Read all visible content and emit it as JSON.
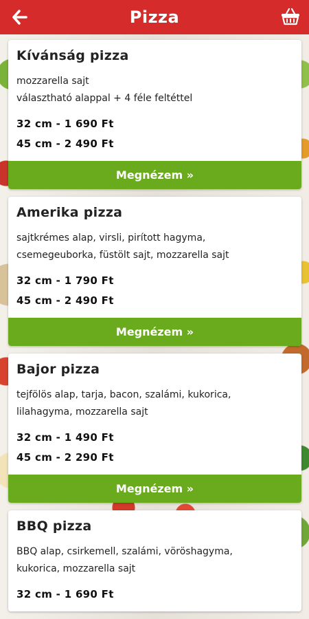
{
  "header": {
    "title": "Pizza",
    "back_icon": "arrow-left-icon",
    "basket_icon": "basket-icon",
    "color": "#d52b2a"
  },
  "accent": "#6aab1e",
  "pizzas": [
    {
      "name": "Kívánság pizza",
      "description": "mozzarella  sajt\nválasztható alappal + 4 féle feltéttel",
      "price_32": "32 cm - 1 690 Ft",
      "price_45": "45 cm - 2 490 Ft",
      "button": "Megnézem »"
    },
    {
      "name": "Amerika pizza",
      "description": "sajtkrémes alap, virsli, pirított hagyma,\ncsemegeuborka, füstölt sajt, mozzarella  sajt",
      "price_32": "32 cm - 1 790 Ft",
      "price_45": "45 cm - 2 490 Ft",
      "button": "Megnézem »"
    },
    {
      "name": "Bajor pizza",
      "description": "tejfölös alap, tarja, bacon, szalámi, kukorica,\nlilahagyma, mozzarella  sajt",
      "price_32": "32 cm - 1 490 Ft",
      "price_45": "45 cm - 2 290 Ft",
      "button": "Megnézem »"
    },
    {
      "name": "BBQ pizza",
      "description": "BBQ alap, csirkemell, szalámi, vöröshagyma,\nkukorica, mozzarella  sajt",
      "price_32": "32 cm - 1 690 Ft",
      "price_45": "",
      "button": ""
    }
  ]
}
